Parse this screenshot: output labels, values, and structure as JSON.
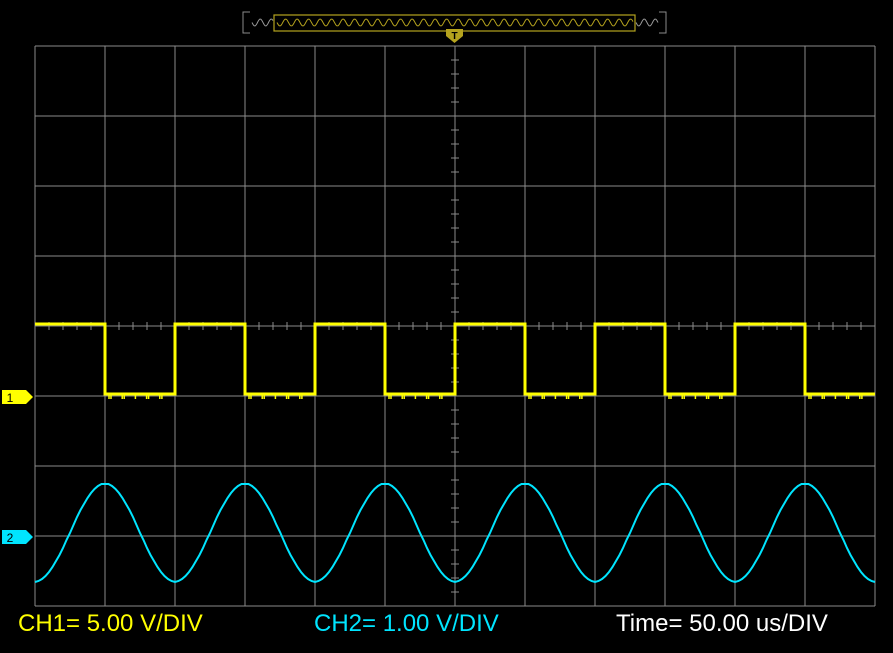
{
  "colors": {
    "background": "#000000",
    "grid": "#8a8a8a",
    "ch1": "#ffff00",
    "ch2": "#00e5ff",
    "trigger": "#b5a31e",
    "footer_time": "#ffffff"
  },
  "markers": {
    "ch1": "1",
    "ch2": "2",
    "trigger": "T"
  },
  "footer": {
    "ch1_scale": "CH1= 5.00 V/DIV",
    "ch2_scale": "CH2= 1.00 V/DIV",
    "time_scale": "Time= 50.00 us/DIV"
  },
  "chart_data": {
    "type": "line",
    "grid": true,
    "x_divisions": 12,
    "y_divisions": 8,
    "xlim": [
      -300,
      300
    ],
    "xunit": "us",
    "series": [
      {
        "name": "CH1",
        "waveform": "square",
        "x": [
          -300,
          -250,
          -250,
          -200,
          -200,
          -150,
          -150,
          -100,
          -100,
          -50,
          -50,
          0,
          0,
          50,
          50,
          100,
          100,
          150,
          150,
          200,
          200,
          250,
          250,
          300
        ],
        "y": [
          1,
          1,
          0,
          0,
          1,
          1,
          0,
          0,
          1,
          1,
          0,
          0,
          1,
          1,
          0,
          0,
          1,
          1,
          0,
          0,
          1,
          1,
          0,
          0
        ],
        "high_div": 1.0,
        "low_div": 0.0,
        "yunit": "div"
      },
      {
        "name": "CH2",
        "waveform": "sine",
        "period_us": 100,
        "peak_x_us": [
          -250,
          -150,
          -50,
          50,
          150,
          250
        ],
        "max_div": 0.75,
        "min_div": -0.65,
        "yunit": "div"
      }
    ]
  }
}
